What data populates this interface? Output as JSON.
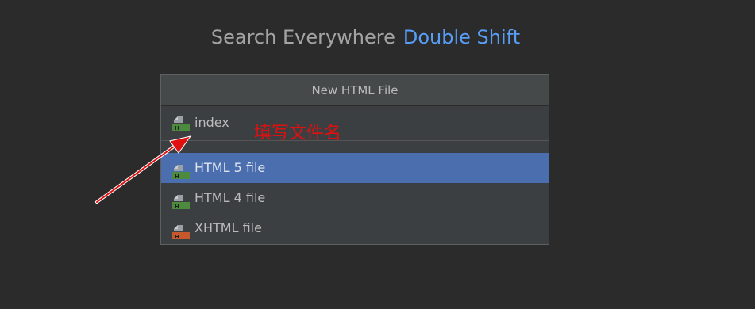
{
  "hint": {
    "text": "Search Everywhere",
    "shortcut": "Double Shift"
  },
  "dialog": {
    "title": "New HTML File",
    "name_input_value": "index",
    "templates": [
      {
        "label": "HTML 5 file",
        "icon": "html-file-icon",
        "selected": true
      },
      {
        "label": "HTML 4 file",
        "icon": "html-file-icon",
        "selected": false
      },
      {
        "label": "XHTML file",
        "icon": "xhtml-file-icon",
        "selected": false
      }
    ]
  },
  "annotation": {
    "text": "填写文件名"
  },
  "colors": {
    "background": "#2b2b2b",
    "dialog_bg": "#3c3f41",
    "selection": "#4b6eaf",
    "shortcut": "#589df6",
    "annotation": "#e01010",
    "html_icon": "#4c8b3d",
    "xhtml_icon": "#c6582b"
  }
}
